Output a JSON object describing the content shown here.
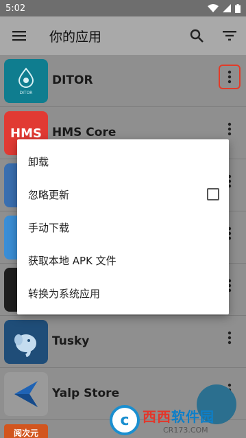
{
  "status_bar": {
    "time": "5:02"
  },
  "app_bar": {
    "title": "你的应用",
    "menu_icon": "hamburger-menu-icon",
    "search_icon": "search-icon",
    "filter_icon": "filter-icon"
  },
  "apps": [
    {
      "name": "DITOR",
      "icon_text": "DITOR",
      "icon_color": "#0f7d8f"
    },
    {
      "name": "HMS Core",
      "icon_text": "HMS",
      "icon_color": "#e13a33"
    },
    {
      "name": "",
      "icon_color": "#3a6fb0"
    },
    {
      "name": "",
      "icon_color": "#3a8ed6"
    },
    {
      "name": "",
      "icon_color": "#1e1e1e"
    },
    {
      "name": "Tusky",
      "icon_color": "#1f4d78"
    },
    {
      "name": "Yalp Store",
      "icon_color": "#1f63b5"
    },
    {
      "name": "",
      "icon_text": "阅次元",
      "icon_color": "#d2551e"
    }
  ],
  "context_menu": {
    "items": [
      {
        "label": "卸载"
      },
      {
        "label": "忽略更新",
        "checked": false
      },
      {
        "label": "手动下载"
      },
      {
        "label": "获取本地 APK 文件"
      },
      {
        "label": "转换为系统应用"
      }
    ]
  },
  "watermark": {
    "logo": "c",
    "part1": "西西",
    "part2": "软件园",
    "url": "CR173.COM"
  }
}
